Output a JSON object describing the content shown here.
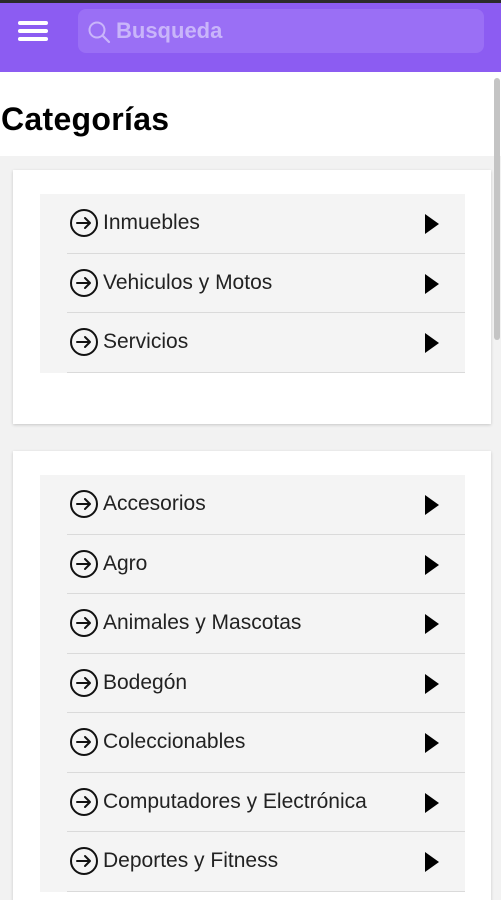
{
  "header": {
    "menu_icon": "hamburger-menu-icon",
    "search_icon": "search-icon",
    "search_placeholder": "Busqueda",
    "accent_color": "#8c5cf2"
  },
  "page": {
    "title": "Categorías"
  },
  "groups": [
    {
      "items": [
        {
          "label": "Inmuebles"
        },
        {
          "label": "Vehiculos y Motos"
        },
        {
          "label": "Servicios"
        }
      ]
    },
    {
      "items": [
        {
          "label": "Accesorios"
        },
        {
          "label": "Agro"
        },
        {
          "label": "Animales y Mascotas"
        },
        {
          "label": "Bodegón"
        },
        {
          "label": "Coleccionables"
        },
        {
          "label": "Computadores y Electrónica"
        },
        {
          "label": "Deportes y Fitness"
        }
      ]
    }
  ]
}
